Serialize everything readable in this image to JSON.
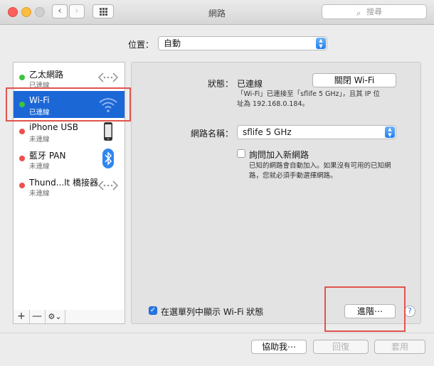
{
  "window": {
    "title": "網路"
  },
  "toolbar": {
    "back": "‹",
    "forward": "›"
  },
  "search": {
    "placeholder": "搜尋"
  },
  "location": {
    "label": "位置：",
    "value": "自動"
  },
  "services": [
    {
      "name": "乙太網路",
      "status": "已連線",
      "dot": "green",
      "icon": "ethernet-arrows-icon"
    },
    {
      "name": "Wi-Fi",
      "status": "已連線",
      "dot": "green",
      "icon": "wifi-icon"
    },
    {
      "name": "iPhone USB",
      "status": "未連線",
      "dot": "red",
      "icon": "iphone-icon"
    },
    {
      "name": "藍牙 PAN",
      "status": "未連線",
      "dot": "red",
      "icon": "bluetooth-icon"
    },
    {
      "name": "Thund...lt 橋接器",
      "status": "未連線",
      "dot": "red",
      "icon": "ethernet-arrows-icon"
    }
  ],
  "sidebar_footer": {
    "add": "+",
    "remove": "—",
    "gear": "⚙︎⌄"
  },
  "detail": {
    "status_label": "狀態：",
    "status_value": "已連線",
    "toggle_button": "關閉 Wi-Fi",
    "status_note_line1": "「Wi-Fi」已連接至「sflife 5 GHz」，且其 IP 位",
    "status_note_line2": "址為 192.168.0.184。",
    "network_label": "網路名稱：",
    "network_value": "sflife 5 GHz",
    "ask_label": "詢問加入新網路",
    "ask_note_line1": "已知的網路會自動加入。如果沒有可用的已知網",
    "ask_note_line2": "路，您就必須手動選擇網路。",
    "show_menu_label": "在選單列中顯示 Wi-Fi 狀態",
    "advanced_button": "進階⋯",
    "help": "?"
  },
  "bottom": {
    "assist": "協助我⋯",
    "revert": "回復",
    "apply": "套用"
  },
  "colors": {
    "selection": "#1c67d6",
    "accent": "#2677e8",
    "highlight_box": "#e0544e"
  }
}
